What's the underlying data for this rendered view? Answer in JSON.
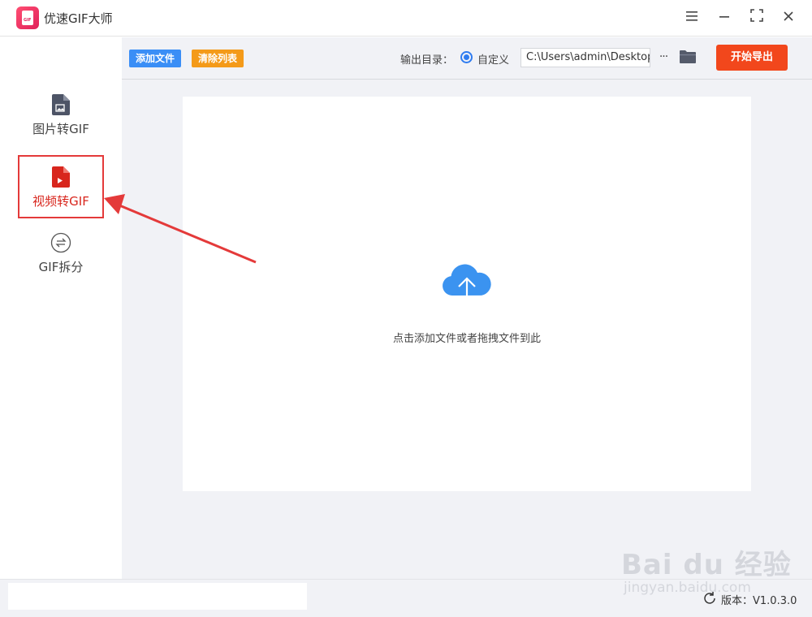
{
  "app": {
    "title": "优速GIF大师",
    "logo_text": "GIF"
  },
  "sidebar": {
    "items": [
      {
        "label": "图片转GIF",
        "icon": "image-doc-icon",
        "active": false
      },
      {
        "label": "视频转GIF",
        "icon": "video-doc-icon",
        "active": true
      },
      {
        "label": "GIF拆分",
        "icon": "split-icon",
        "active": false
      }
    ]
  },
  "toolbar": {
    "add_label": "添加文件",
    "clear_label": "清除列表",
    "output_label": "输出目录：",
    "radio_label": "自定义",
    "path_value": "C:\\Users\\admin\\Desktop",
    "more_label": "···",
    "start_label": "开始导出"
  },
  "main": {
    "drop_text": "点击添加文件或者拖拽文件到此"
  },
  "status": {
    "version": "版本：V1.0.3.0"
  },
  "watermark": {
    "main": "Bai du 经验",
    "sub": "jingyan.baidu.com"
  },
  "colors": {
    "accent_blue": "#3a8ef6",
    "accent_orange": "#f49a19",
    "start_red": "#f2471c",
    "highlight_red": "#e43a3a",
    "cloud_blue": "#3b93f0"
  }
}
